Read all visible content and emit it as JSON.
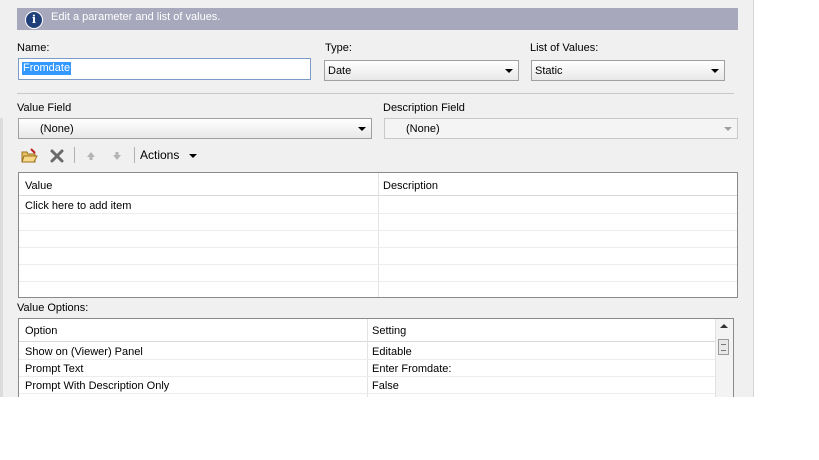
{
  "info": {
    "text": "Edit a parameter and list of values."
  },
  "name": {
    "label": "Name:",
    "value": "Fromdate"
  },
  "type": {
    "label": "Type:",
    "value": "Date"
  },
  "list_of_values": {
    "label": "List of Values:",
    "value": "Static"
  },
  "value_field": {
    "label": "Value Field",
    "value": "(None)"
  },
  "description_field": {
    "label": "Description Field",
    "value": "(None)"
  },
  "toolbar": {
    "actions_label": "Actions"
  },
  "values_grid": {
    "headers": [
      "Value",
      "Description"
    ],
    "rows": [
      [
        "Click here to add item",
        ""
      ]
    ]
  },
  "value_options": {
    "label": "Value Options:",
    "headers": [
      "Option",
      "Setting"
    ],
    "rows": [
      [
        "Show on (Viewer) Panel",
        "Editable"
      ],
      [
        "Prompt Text",
        "Enter Fromdate:"
      ],
      [
        "Prompt With Description Only",
        "False"
      ]
    ]
  }
}
